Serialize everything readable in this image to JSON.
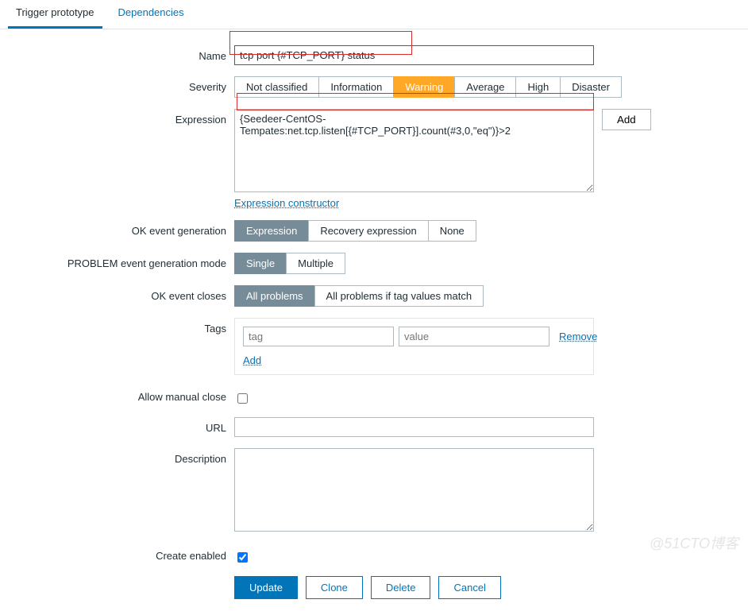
{
  "tabs": {
    "trigger": "Trigger prototype",
    "deps": "Dependencies"
  },
  "labels": {
    "name": "Name",
    "severity": "Severity",
    "expression": "Expression",
    "ok_event_gen": "OK event generation",
    "problem_mode": "PROBLEM event generation mode",
    "ok_closes": "OK event closes",
    "tags": "Tags",
    "allow_manual": "Allow manual close",
    "url": "URL",
    "description": "Description",
    "create_enabled": "Create enabled"
  },
  "name_value": "tcp port {#TCP_PORT} status",
  "severity": {
    "not_classified": "Not classified",
    "information": "Information",
    "warning": "Warning",
    "average": "Average",
    "high": "High",
    "disaster": "Disaster"
  },
  "expression_value": "{Seedeer-CentOS-Tempates:net.tcp.listen[{#TCP_PORT}].count(#3,0,\"eq\")}>2",
  "add_btn": "Add",
  "expr_constructor": "Expression constructor",
  "ok_gen": {
    "expression": "Expression",
    "recovery": "Recovery expression",
    "none": "None"
  },
  "problem": {
    "single": "Single",
    "multiple": "Multiple"
  },
  "closes": {
    "all": "All problems",
    "tag": "All problems if tag values match"
  },
  "tags": {
    "tag_ph": "tag",
    "value_ph": "value",
    "remove": "Remove",
    "add": "Add"
  },
  "url_value": "",
  "description_value": "",
  "actions": {
    "update": "Update",
    "clone": "Clone",
    "delete": "Delete",
    "cancel": "Cancel"
  },
  "watermark": "@51CTO博客"
}
